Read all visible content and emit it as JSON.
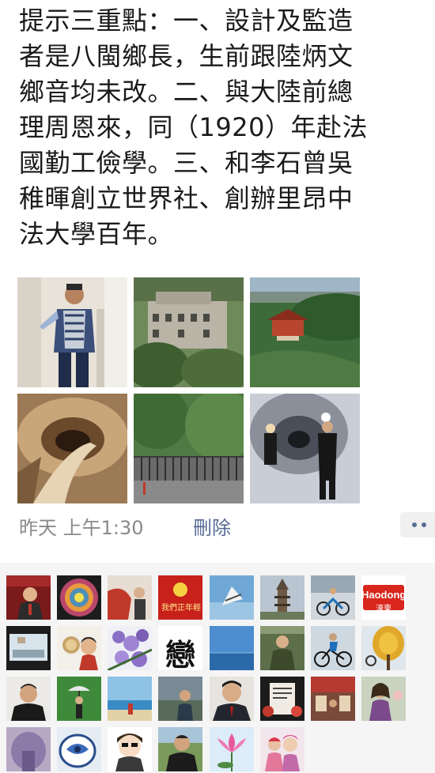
{
  "post": {
    "lines": [
      "提示三重點：一、設計及監造",
      "者是八閩鄉長，生前跟陸炳文",
      "鄉音均未改。二、與大陸前總",
      "理周恩來，同（1920）年赴法",
      "國勤工儉學。三、和李石曾吳",
      "稚暉創立世界社、創辦里昂中",
      "法大學百年。"
    ]
  },
  "meta": {
    "time": "昨天 上午1:30",
    "delete_label": "刪除"
  },
  "likes": {
    "haodong_brand": "Haodong",
    "haodong_sub": "濠東",
    "lian_char": "戀",
    "badge_text": "我們正年輕"
  },
  "colors": {
    "link": "#586b94",
    "meta_gray": "#8a8a8a",
    "panel_bg": "#f5f5f5"
  }
}
